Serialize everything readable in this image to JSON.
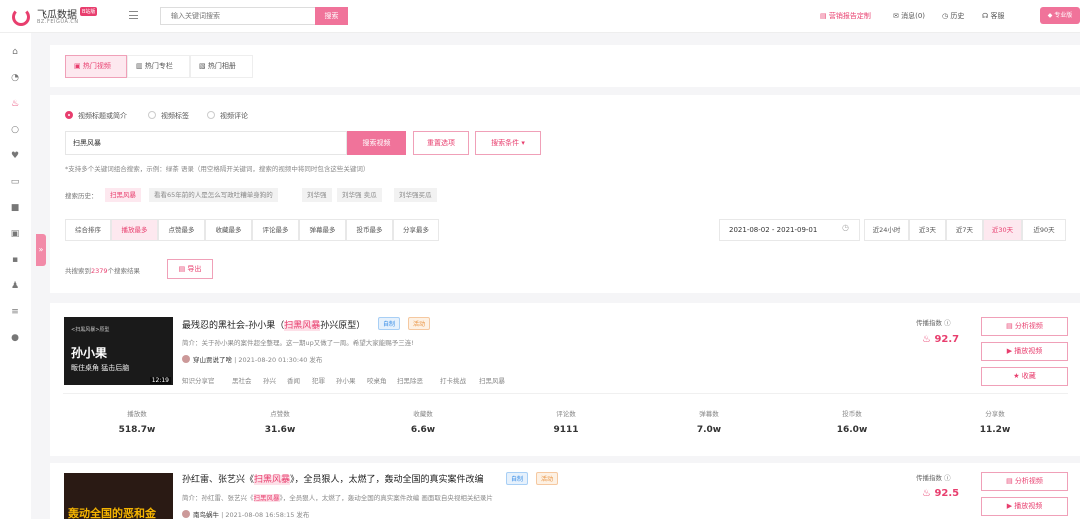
{
  "brand": {
    "name": "飞瓜数据",
    "badge": "B站版",
    "domain": "BZ.FEIGUA.CN"
  },
  "search": {
    "placeholder": "输入关键词搜索",
    "button": "搜索"
  },
  "header": {
    "ad_custom": "营销报告定制",
    "messages": "消息(0)",
    "history": "历史",
    "service": "客服",
    "pro": "专业版"
  },
  "tabs": [
    "热门视频",
    "热门专栏",
    "热门相册"
  ],
  "radios": [
    "视频标题或简介",
    "视频标签",
    "视频评论"
  ],
  "query": {
    "keyword": "扫黑风暴",
    "search_button": "搜索视频",
    "reset_button": "重置选项",
    "conditions_button": "搜索条件",
    "hint": "*支持多个关键词组合搜索，示例：绿茶 语录（用空格隔开关键词，搜索的视频中将同时包含这些关键词）"
  },
  "history": {
    "label": "搜索历史：",
    "items": [
      "扫黑风暴",
      "看看65年前的人是怎么写政吐糟单身狗的",
      "刘华强",
      "刘华强 卖瓜",
      "刘华强买瓜"
    ]
  },
  "sorts": [
    "综合排序",
    "播放最多",
    "点赞最多",
    "收藏最多",
    "评论最多",
    "弹幕最多",
    "投币最多",
    "分享最多"
  ],
  "date_range": "2021-08-02 - 2021-09-01",
  "ranges": [
    "近24小时",
    "近3天",
    "近7天",
    "近30天",
    "近90天"
  ],
  "result": {
    "prefix": "共搜索到",
    "count": "2379",
    "suffix": "个搜索结果",
    "export": "导出"
  },
  "videos": [
    {
      "thumb_caption": "<扫黑风暴>原型",
      "thumb_title": "孙小果",
      "thumb_sub": "畈住桌角 猛击后脑",
      "duration": "12:19",
      "title_pre": "最残忍的黑社会-孙小果（",
      "title_hl": "扫黑风暴",
      "title_post": "孙兴原型）",
      "tag_self": "自制",
      "tag_act": "活动",
      "desc_label": "简介：",
      "desc_pre": "关于孙小果的案件超全整理。这一期up又做了一周。希望大家能赐予三连!",
      "desc_hl": "",
      "desc_post": "",
      "author": "穿山贾说了啥",
      "meta": "| 2021-08-20 01:30:40 发布",
      "kw_tags": [
        "知识分享官",
        "黑社会",
        "孙兴",
        "香闻",
        "犯罪",
        "孙小果",
        "咬桌角",
        "扫黑除恶",
        "打卡挑战",
        "扫黑风暴"
      ],
      "index_label": "传播指数",
      "index_value": "92.7",
      "actions": [
        "分析视频",
        "播放视频",
        "收藏"
      ],
      "stats": [
        {
          "label": "播放数",
          "value": "518.7w"
        },
        {
          "label": "点赞数",
          "value": "31.6w"
        },
        {
          "label": "收藏数",
          "value": "6.6w"
        },
        {
          "label": "评论数",
          "value": "9111"
        },
        {
          "label": "弹幕数",
          "value": "7.0w"
        },
        {
          "label": "投币数",
          "value": "16.0w"
        },
        {
          "label": "分享数",
          "value": "11.2w"
        }
      ]
    },
    {
      "thumb_caption": "",
      "thumb_title": "轰动全国的恶和金",
      "thumb_sub": "",
      "duration": "",
      "title_pre": "孙红雷、张艺兴《",
      "title_hl": "扫黑风暴",
      "title_post": "》，全员狠人，太燃了，轰动全国的真实案件改编",
      "tag_self": "自制",
      "tag_act": "活动",
      "desc_label": "简介：",
      "desc_pre": "孙红雷、张艺兴《",
      "desc_hl": "扫黑风暴",
      "desc_post": "》，全员狠人，太燃了，轰动全国的真实案件改编 画面取自央视相关纪录片",
      "author": "南鸟蜗牛",
      "meta": "| 2021-08-08 16:58:15 发布",
      "index_label": "传播指数",
      "index_value": "92.5",
      "actions": [
        "分析视频",
        "播放视频"
      ]
    }
  ],
  "colors": {
    "accent": "#e83e6e",
    "accent_light": "#fde8ef"
  }
}
